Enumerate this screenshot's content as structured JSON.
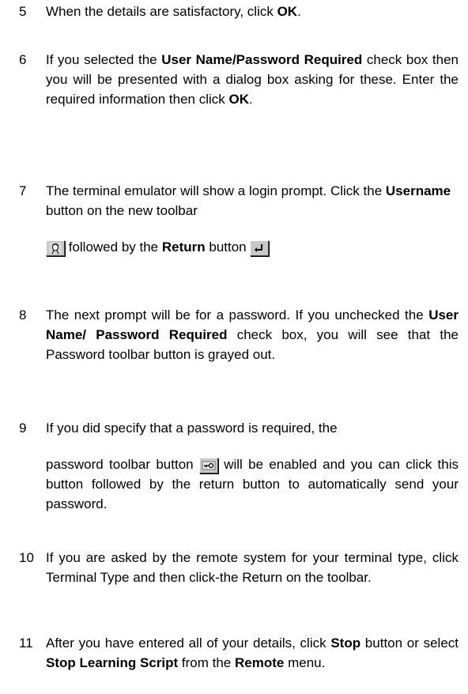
{
  "steps": [
    {
      "num": "5",
      "a": "When the details are satisfactory, click ",
      "b": "OK",
      "c": "."
    },
    {
      "num": "6",
      "a": "If you selected the ",
      "b": "User Name/Password Required",
      "c": " check box then you will be presented with a dialog box asking for these. Enter the required information then click ",
      "d": "OK",
      "e": "."
    },
    {
      "num": "7",
      "a": "The terminal emulator will show a login prompt. Click the ",
      "b": "Username",
      "c": " button on the new toolbar",
      "d": " followed by the ",
      "e": "Return",
      "f": " button ",
      "icon1": "username-button-icon",
      "icon2": "return-button-icon"
    },
    {
      "num": "8",
      "a": "The next prompt will be for a password. If you unchecked the ",
      "b": "User Name/ Password Required",
      "c": " check box, you will see that the Password toolbar button is grayed out."
    },
    {
      "num": "9",
      "a": "If you did specify that a password is required, the",
      "b": "password toolbar button ",
      "c": " will be enabled and you can click this button followed by the return button to automatically send your password.",
      "icon": "password-button-icon"
    },
    {
      "num": "10",
      "a": "If you are asked by the remote system for your terminal type, click Terminal Type and then click-the Return on the toolbar."
    },
    {
      "num": "11",
      "a": "After you have entered all of your details, click ",
      "b": "Stop",
      "c": " button or select ",
      "d": "Stop Learning Script",
      "e": " from the ",
      "f": "Remote",
      "g": " menu."
    }
  ]
}
